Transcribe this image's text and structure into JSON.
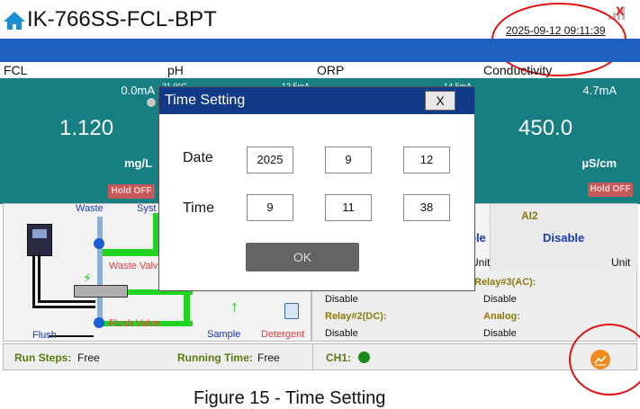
{
  "header": {
    "title": "IK-766SS-FCL-BPT",
    "datetime": "2025-09-12 09:11:39",
    "alert_mark": "X"
  },
  "columns": {
    "fcl": "FCL",
    "ph": "pH",
    "orp": "ORP",
    "conductivity": "Conductivity"
  },
  "panels": {
    "fcl": {
      "current": "0.0mA",
      "value": "1.120",
      "unit": "mg/L",
      "hold": "Hold OFF"
    },
    "ph_partial": {
      "range_text": "21.0°C",
      "range_right": "12.5mA"
    },
    "orp_partial": {
      "range_right": "14.5mA"
    },
    "conductivity": {
      "current": "4.7mA",
      "value": "450.0",
      "unit": "µS/cm",
      "hold": "Hold OFF"
    }
  },
  "diagram": {
    "waste": "Waste",
    "system": "Syst",
    "waste_valve": "Waste Valv",
    "flush_valve": "Flush Valve",
    "flush": "Flush",
    "sample": "Sample",
    "detergent": "Detergent"
  },
  "info": {
    "ai2_label": "AI2",
    "ai1_partial": "ble",
    "ai2_value": "Disable",
    "unit_left": "Unit",
    "unit_right": "Unit",
    "relay3": "Relay#3(AC):",
    "disable_a": "Disable",
    "disable_b": "Disable",
    "relay2": "Relay#2(DC):",
    "analog": "Analog:",
    "disable_c": "Disable",
    "disable_d": "Disable"
  },
  "footer": {
    "run_steps_label": "Run Steps:",
    "run_steps_value": "Free",
    "running_time_label": "Running Time:",
    "running_time_value": "Free",
    "ch1_label": "CH1:"
  },
  "dialog": {
    "title": "Time Setting",
    "close": "X",
    "date_label": "Date",
    "date_values": [
      "2025",
      "9",
      "12"
    ],
    "time_label": "Time",
    "time_values": [
      "9",
      "11",
      "38"
    ],
    "ok": "OK"
  },
  "caption": "Figure 15 - Time Setting",
  "colors": {
    "header_bar": "#1e5fbf",
    "panel": "#157f82",
    "dialog_title": "#123a86",
    "annotation": "#e01010",
    "chart_button": "#f08a1a"
  }
}
